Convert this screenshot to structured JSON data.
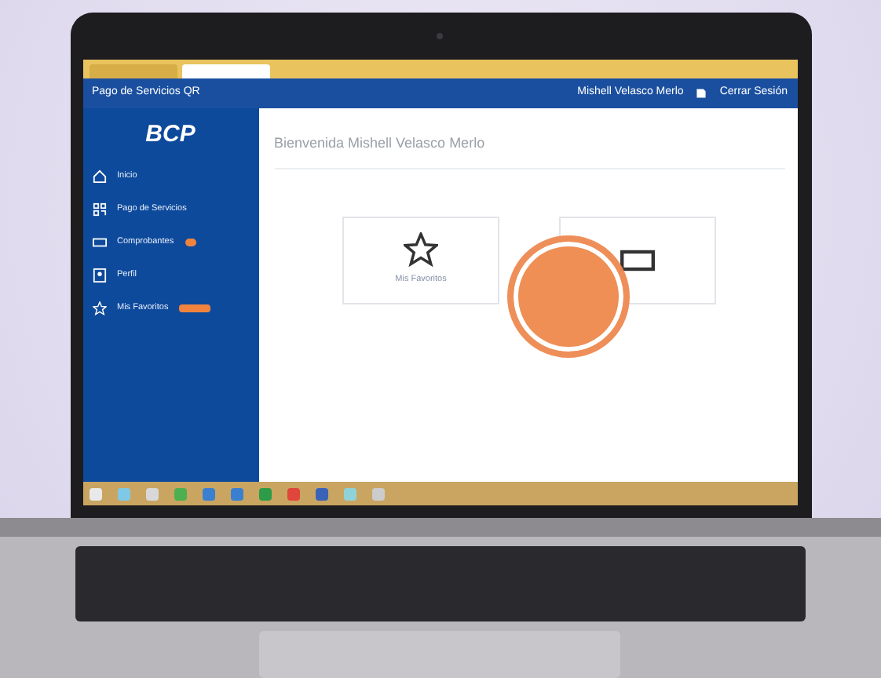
{
  "browser_tabs": [
    {
      "selected": false
    },
    {
      "selected": true
    }
  ],
  "app_header": {
    "title": "Pago de Servicios QR",
    "user": "Mishell Velasco Merlo",
    "logout": "Cerrar Sesión"
  },
  "sidebar": {
    "logo": "BCP",
    "items": [
      {
        "label": "Inicio",
        "kind": "home"
      },
      {
        "label": "Pago de Servicios",
        "kind": "qr"
      },
      {
        "label": "Comprobantes",
        "kind": "ticket",
        "badge": {
          "kind": "dot"
        }
      },
      {
        "label": "Perfil",
        "kind": "profile"
      },
      {
        "label": "Mis Favoritos",
        "kind": "star",
        "badge": {
          "kind": "pill"
        }
      }
    ]
  },
  "main": {
    "welcome": "Bienvenida Mishell Velasco Merlo",
    "cards": [
      {
        "label": "Mis Favoritos",
        "kind": "star"
      },
      {
        "kind": "ticket"
      }
    ]
  },
  "touch_indicator": true
}
